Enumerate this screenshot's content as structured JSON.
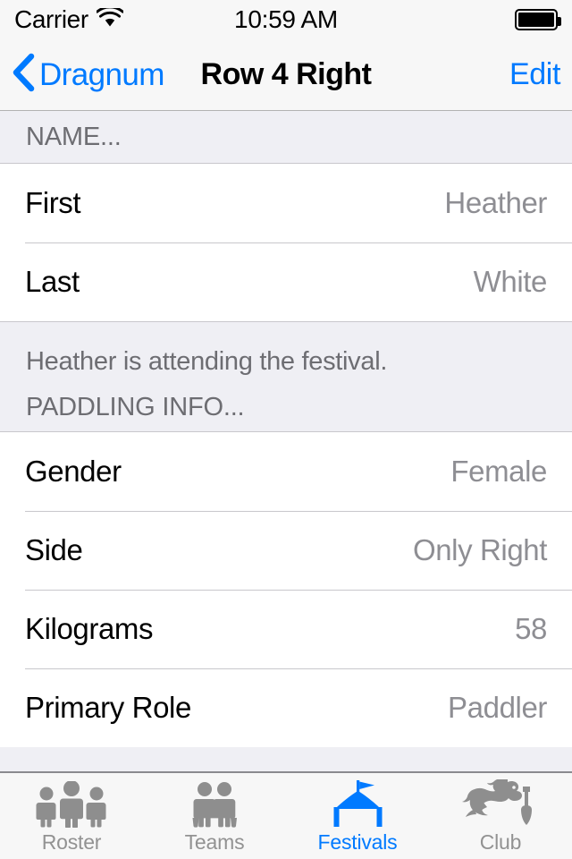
{
  "status_bar": {
    "carrier": "Carrier",
    "wifi_icon": "wifi-icon",
    "time": "10:59 AM",
    "battery_icon": "battery-full-icon",
    "battery_level": 100
  },
  "nav_bar": {
    "back_icon": "chevron-left-icon",
    "back_label": "Dragnum",
    "title": "Row 4 Right",
    "edit_label": "Edit"
  },
  "sections": [
    {
      "header": "NAME...",
      "rows": [
        {
          "label": "First",
          "value": "Heather"
        },
        {
          "label": "Last",
          "value": "White"
        }
      ],
      "footer": "Heather is attending the festival."
    },
    {
      "header": "PADDLING INFO...",
      "rows": [
        {
          "label": "Gender",
          "value": "Female"
        },
        {
          "label": "Side",
          "value": "Only Right"
        },
        {
          "label": "Kilograms",
          "value": "58"
        },
        {
          "label": "Primary Role",
          "value": "Paddler"
        }
      ]
    }
  ],
  "tab_bar": {
    "active_index": 2,
    "accent_color": "#007aff",
    "inactive_color": "#929292",
    "tabs": [
      {
        "label": "Roster",
        "icon": "three-people-icon"
      },
      {
        "label": "Teams",
        "icon": "two-paddlers-icon"
      },
      {
        "label": "Festivals",
        "icon": "festival-tent-icon"
      },
      {
        "label": "Club",
        "icon": "dragon-paddle-icon"
      }
    ]
  }
}
